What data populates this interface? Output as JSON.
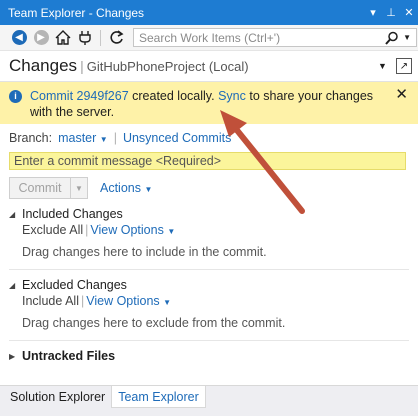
{
  "window": {
    "title": "Team Explorer - Changes",
    "title_buttons": [
      "▾",
      "⊥",
      "✕"
    ]
  },
  "toolbar": {
    "search_placeholder": "Search Work Items (Ctrl+')"
  },
  "header": {
    "title": "Changes",
    "separator": "|",
    "repo": "GitHubPhoneProject (Local)"
  },
  "infobar": {
    "commit_link": "Commit 2949f267",
    "text1": " created locally. ",
    "sync_link": "Sync",
    "text2": " to share your changes with the server.",
    "close": "✕"
  },
  "branch": {
    "label": "Branch:",
    "value": "master",
    "separator": "|",
    "unsynced": "Unsynced Commits"
  },
  "commit_message": {
    "placeholder": "Enter a commit message <Required>"
  },
  "commit_row": {
    "commit_label": "Commit",
    "actions_label": "Actions"
  },
  "sections": {
    "included": {
      "title": "Included Changes",
      "exclude_all": "Exclude All",
      "separator": "|",
      "view_options": "View Options",
      "hint": "Drag changes here to include in the commit."
    },
    "excluded": {
      "title": "Excluded Changes",
      "include_all": "Include All",
      "separator": "|",
      "view_options": "View Options",
      "hint": "Drag changes here to exclude from the commit."
    },
    "untracked": {
      "title": "Untracked Files"
    }
  },
  "tabs": [
    {
      "label": "Solution Explorer",
      "active": false
    },
    {
      "label": "Team Explorer",
      "active": true
    }
  ],
  "colors": {
    "titlebar": "#1e7cd2",
    "link": "#1e6bb8",
    "infobar": "#fef2a8",
    "commit_field": "#fbf59b",
    "arrow": "#c0503a"
  }
}
